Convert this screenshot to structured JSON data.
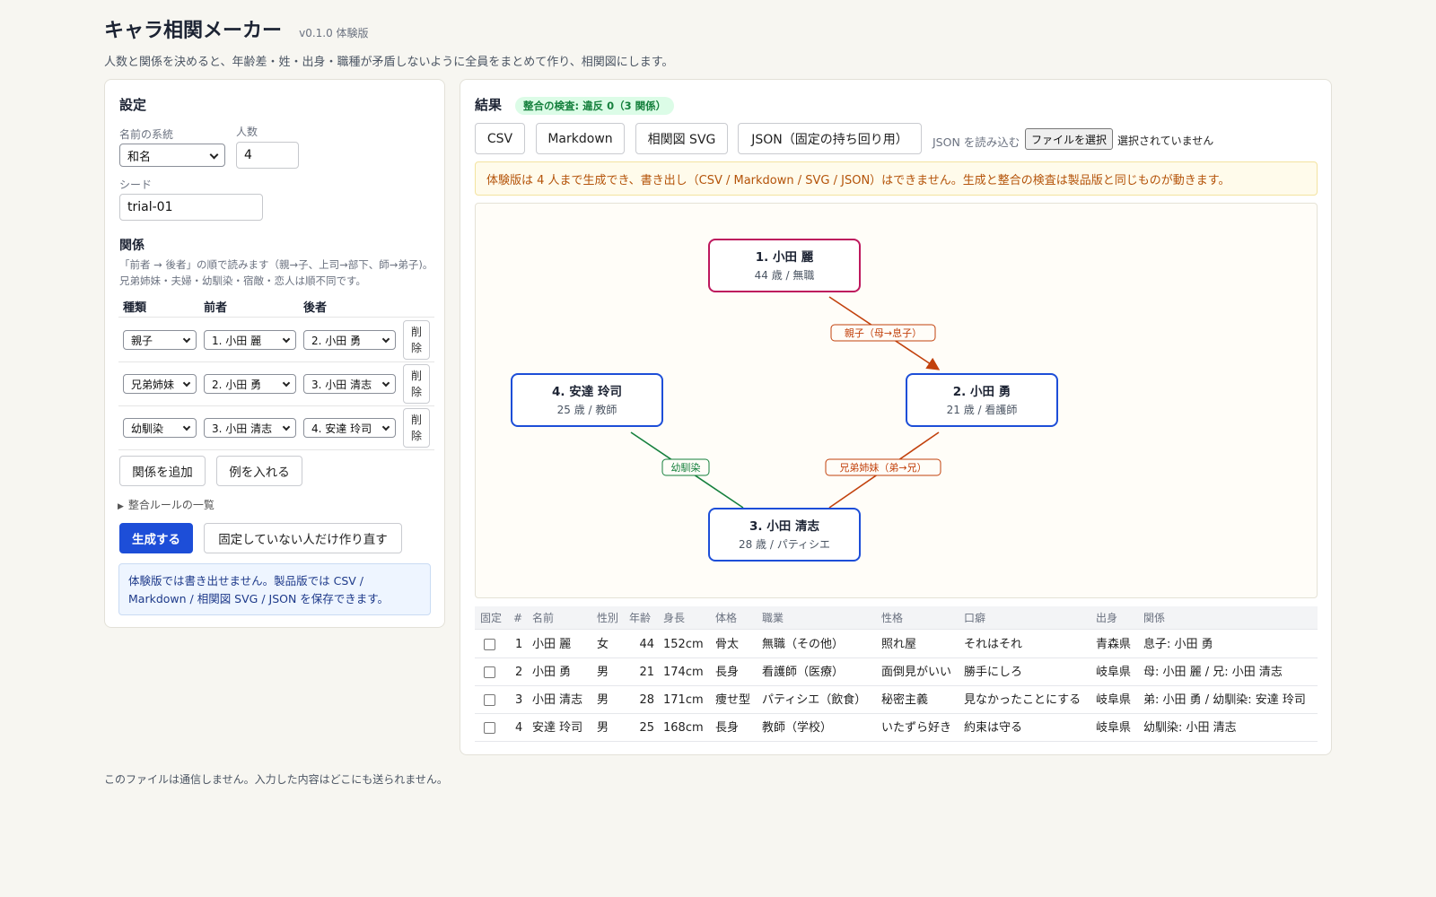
{
  "header": {
    "title": "キャラ相関メーカー",
    "version": "v0.1.0 体験版",
    "description": "人数と関係を決めると、年齢差・姓・出身・職種が矛盾しないように全員をまとめて作り、相関図にします。"
  },
  "settings": {
    "title": "設定",
    "name_system_label": "名前の系統",
    "name_system_value": "和名",
    "count_label": "人数",
    "count_value": "4",
    "seed_label": "シード",
    "seed_value": "trial-01",
    "relations_heading": "関係",
    "relations_hint": "「前者 → 後者」の順で読みます（親→子、上司→部下、師→弟子)。兄弟姉妹・夫婦・幼馴染・宿敵・恋人は順不同です。",
    "columns": [
      "種類",
      "前者",
      "後者"
    ],
    "rows": [
      {
        "type": "親子",
        "a": "1. 小田 麗",
        "b": "2. 小田 勇",
        "delete": "削除"
      },
      {
        "type": "兄弟姉妹",
        "a": "2. 小田 勇",
        "b": "3. 小田 清志",
        "delete": "削除"
      },
      {
        "type": "幼馴染",
        "a": "3. 小田 清志",
        "b": "4. 安達 玲司",
        "delete": "削除"
      }
    ],
    "add_relation": "関係を追加",
    "insert_example": "例を入れる",
    "rules_toggle": "整合ルールの一覧",
    "generate": "生成する",
    "regenerate_unpinned": "固定していない人だけ作り直す",
    "trial_note": "体験版では書き出せません。製品版では CSV / Markdown / 相関図 SVG / JSON を保存できます。"
  },
  "results": {
    "title": "結果",
    "check_badge": "整合の検査: 違反 0（3 関係）",
    "export_buttons": [
      "CSV",
      "Markdown",
      "相関図 SVG",
      "JSON（固定の持ち回り用）"
    ],
    "json_load_label": "JSON を読み込む",
    "file_button": "ファイルを選択",
    "file_status": "選択されていません",
    "notice": "体験版は 4 人まで生成でき、書き出し（CSV / Markdown / SVG / JSON）はできません。生成と整合の検査は製品版と同じものが動きます。",
    "graph": {
      "nodes": [
        {
          "name": "1. 小田 麗",
          "sub": "44 歳 / 無職",
          "color": "#be185d"
        },
        {
          "name": "2. 小田 勇",
          "sub": "21 歳 / 看護師",
          "color": "#1d4ed8"
        },
        {
          "name": "3. 小田 清志",
          "sub": "28 歳 / パティシエ",
          "color": "#1d4ed8"
        },
        {
          "name": "4. 安達 玲司",
          "sub": "25 歳 / 教師",
          "color": "#1d4ed8"
        }
      ],
      "edges": [
        {
          "label": "親子（母→息子）",
          "color": "#c2410c"
        },
        {
          "label": "兄弟姉妹（弟→兄）",
          "color": "#c2410c"
        },
        {
          "label": "幼馴染",
          "color": "#15803d"
        }
      ]
    },
    "table": {
      "headers": [
        "固定",
        "#",
        "名前",
        "性別",
        "年齢",
        "身長",
        "体格",
        "職業",
        "性格",
        "口癖",
        "出身",
        "関係"
      ],
      "rows": [
        {
          "no": "1",
          "name": "小田 麗",
          "sex": "女",
          "age": "44",
          "height": "152cm",
          "build": "骨太",
          "job": "無職（その他）",
          "personality": "照れ屋",
          "catchphrase": "それはそれ",
          "origin": "青森県",
          "relations": "息子: 小田 勇"
        },
        {
          "no": "2",
          "name": "小田 勇",
          "sex": "男",
          "age": "21",
          "height": "174cm",
          "build": "長身",
          "job": "看護師（医療）",
          "personality": "面倒見がいい",
          "catchphrase": "勝手にしろ",
          "origin": "岐阜県",
          "relations": "母: 小田 麗 / 兄: 小田 清志"
        },
        {
          "no": "3",
          "name": "小田 清志",
          "sex": "男",
          "age": "28",
          "height": "171cm",
          "build": "痩せ型",
          "job": "パティシエ（飲食）",
          "personality": "秘密主義",
          "catchphrase": "見なかったことにする",
          "origin": "岐阜県",
          "relations": "弟: 小田 勇 / 幼馴染: 安達 玲司"
        },
        {
          "no": "4",
          "name": "安達 玲司",
          "sex": "男",
          "age": "25",
          "height": "168cm",
          "build": "長身",
          "job": "教師（学校）",
          "personality": "いたずら好き",
          "catchphrase": "約束は守る",
          "origin": "岐阜県",
          "relations": "幼馴染: 小田 清志"
        }
      ]
    }
  },
  "footer": "このファイルは通信しません。入力した内容はどこにも送られません。"
}
